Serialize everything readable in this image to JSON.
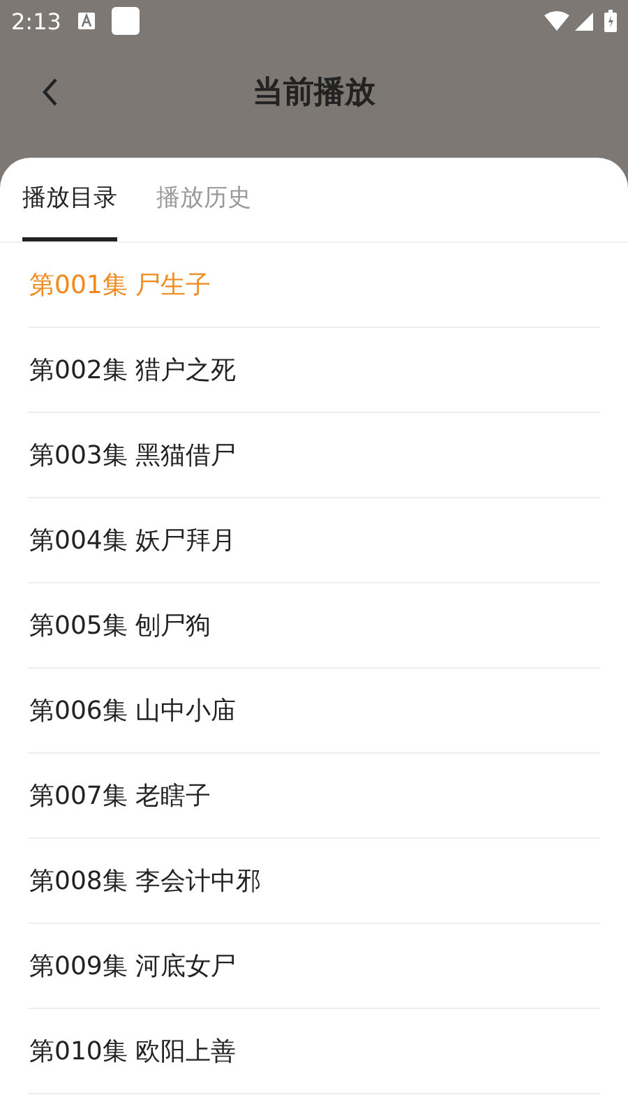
{
  "status_bar": {
    "time": "2:13"
  },
  "header": {
    "title": "当前播放"
  },
  "tabs": [
    {
      "label": "播放目录",
      "selected": true
    },
    {
      "label": "播放历史",
      "selected": false
    }
  ],
  "episodes": [
    {
      "label": "第001集 尸生子",
      "selected": true
    },
    {
      "label": "第002集 猎户之死",
      "selected": false
    },
    {
      "label": "第003集 黑猫借尸",
      "selected": false
    },
    {
      "label": "第004集 妖尸拜月",
      "selected": false
    },
    {
      "label": "第005集 刨尸狗",
      "selected": false
    },
    {
      "label": "第006集 山中小庙",
      "selected": false
    },
    {
      "label": "第007集 老瞎子",
      "selected": false
    },
    {
      "label": "第008集 李会计中邪",
      "selected": false
    },
    {
      "label": "第009集 河底女尸",
      "selected": false
    },
    {
      "label": "第010集 欧阳上善",
      "selected": false
    }
  ]
}
